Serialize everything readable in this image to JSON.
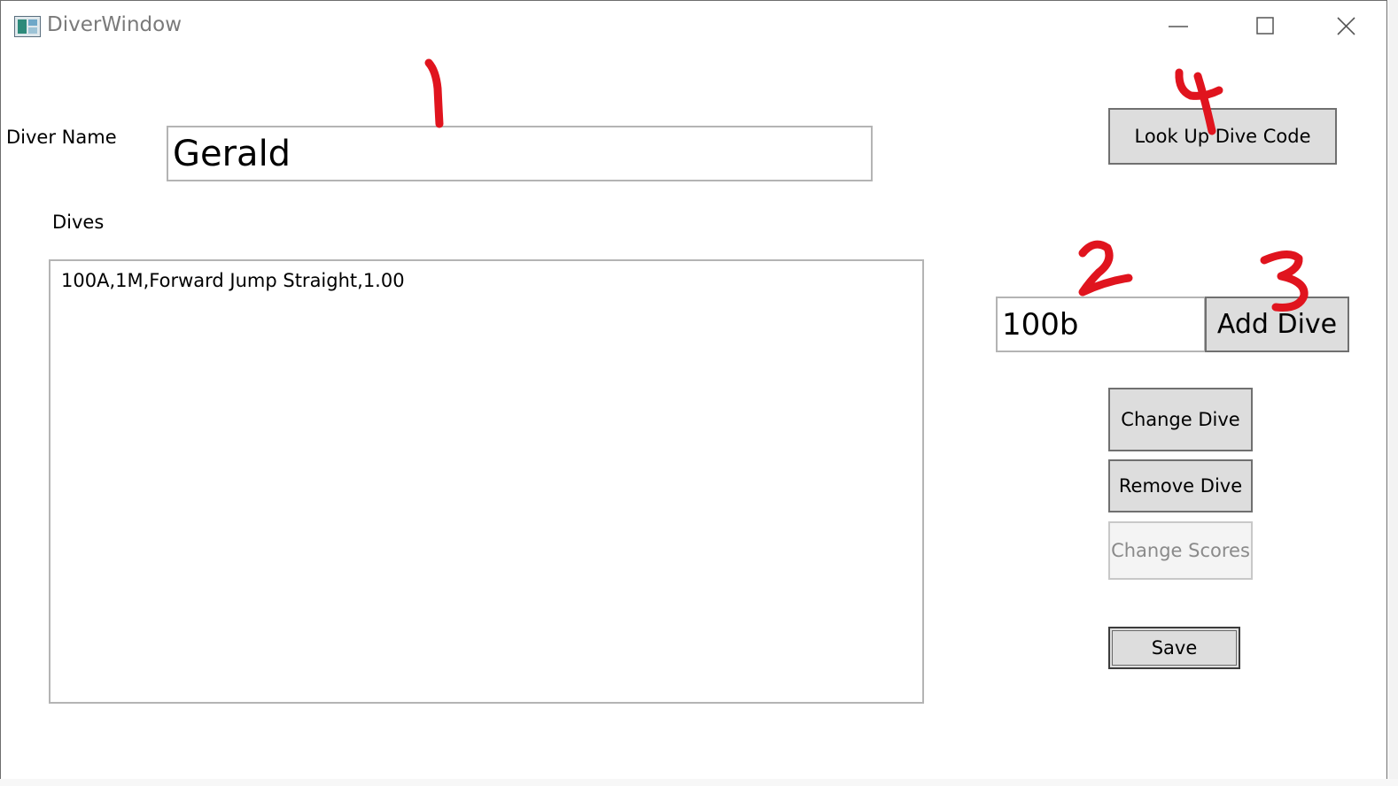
{
  "window": {
    "title": "DiverWindow",
    "controls": {
      "minimize": "minimize-icon",
      "maximize": "maximize-icon",
      "close": "close-icon"
    }
  },
  "form": {
    "diver_name_label": "Diver Name",
    "diver_name_value": "Gerald",
    "dives_label": "Dives",
    "dives": [
      "100A,1M,Forward Jump Straight,1.00"
    ],
    "dive_code_value": "100b"
  },
  "buttons": {
    "look_up": "Look Up Dive Code",
    "add_dive": "Add Dive",
    "change_dive": "Change Dive",
    "remove_dive": "Remove Dive",
    "change_scores": "Change Scores",
    "save": "Save"
  },
  "annotations": {
    "marks": [
      "1",
      "2",
      "3",
      "4"
    ],
    "color": "#e0141e"
  },
  "colors": {
    "button_face": "#dddddd",
    "button_border": "#707070",
    "textbox_border": "#b4b4b4",
    "disabled_text": "#8a8a8a"
  }
}
